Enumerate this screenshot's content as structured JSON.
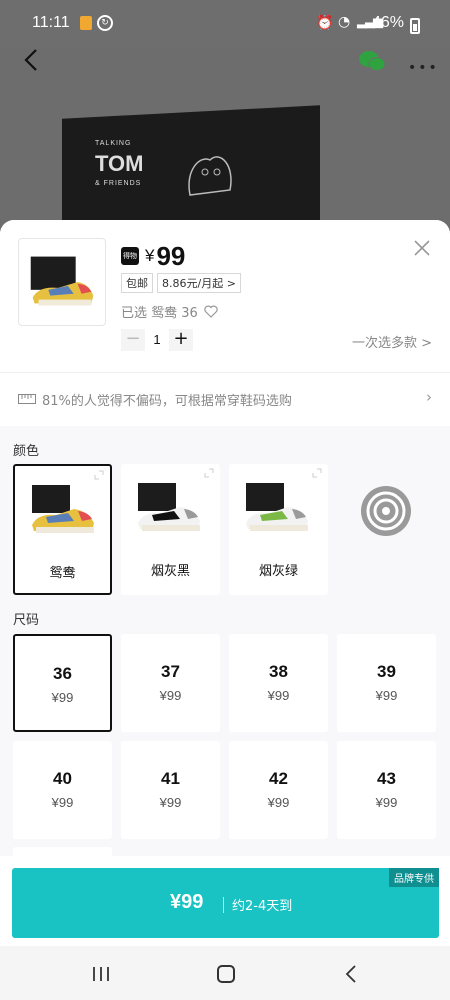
{
  "status_bar": {
    "time": "11:11",
    "battery": "46%"
  },
  "product": {
    "brand_text": "TOM",
    "brand_small": "TALKING",
    "brand_sub": "& FRIENDS",
    "badge": "得物",
    "price_symbol": "¥",
    "price": "99",
    "tags": [
      "包邮",
      "8.86元/月起 >"
    ],
    "selected_text": "已选 鸳鸯 36",
    "quantity": "1",
    "multi_select_link": "一次选多款 >",
    "fit_text": "81%的人觉得不偏码，可根据常穿鞋码选购"
  },
  "color_section": {
    "label": "颜色",
    "options": [
      {
        "name": "鸳鸯",
        "selected": true,
        "colors": [
          "#e8c040",
          "#5a7fb8",
          "#e25050"
        ]
      },
      {
        "name": "烟灰黑",
        "selected": false,
        "colors": [
          "#f2f2f2",
          "#111111",
          "#9a9a9a"
        ]
      },
      {
        "name": "烟灰绿",
        "selected": false,
        "colors": [
          "#f2f2f2",
          "#7bb845",
          "#9a9a9a"
        ]
      }
    ]
  },
  "size_section": {
    "label": "尺码",
    "sizes": [
      {
        "size": "36",
        "price": "¥99",
        "selected": true
      },
      {
        "size": "37",
        "price": "¥99",
        "selected": false
      },
      {
        "size": "38",
        "price": "¥99",
        "selected": false
      },
      {
        "size": "39",
        "price": "¥99",
        "selected": false
      },
      {
        "size": "40",
        "price": "¥99",
        "selected": false
      },
      {
        "size": "41",
        "price": "¥99",
        "selected": false
      },
      {
        "size": "42",
        "price": "¥99",
        "selected": false
      },
      {
        "size": "43",
        "price": "¥99",
        "selected": false
      }
    ]
  },
  "buy": {
    "price": "¥99",
    "eta": "约2-4天到",
    "badge": "品牌专供",
    "accent_color": "#1ac3c3"
  }
}
